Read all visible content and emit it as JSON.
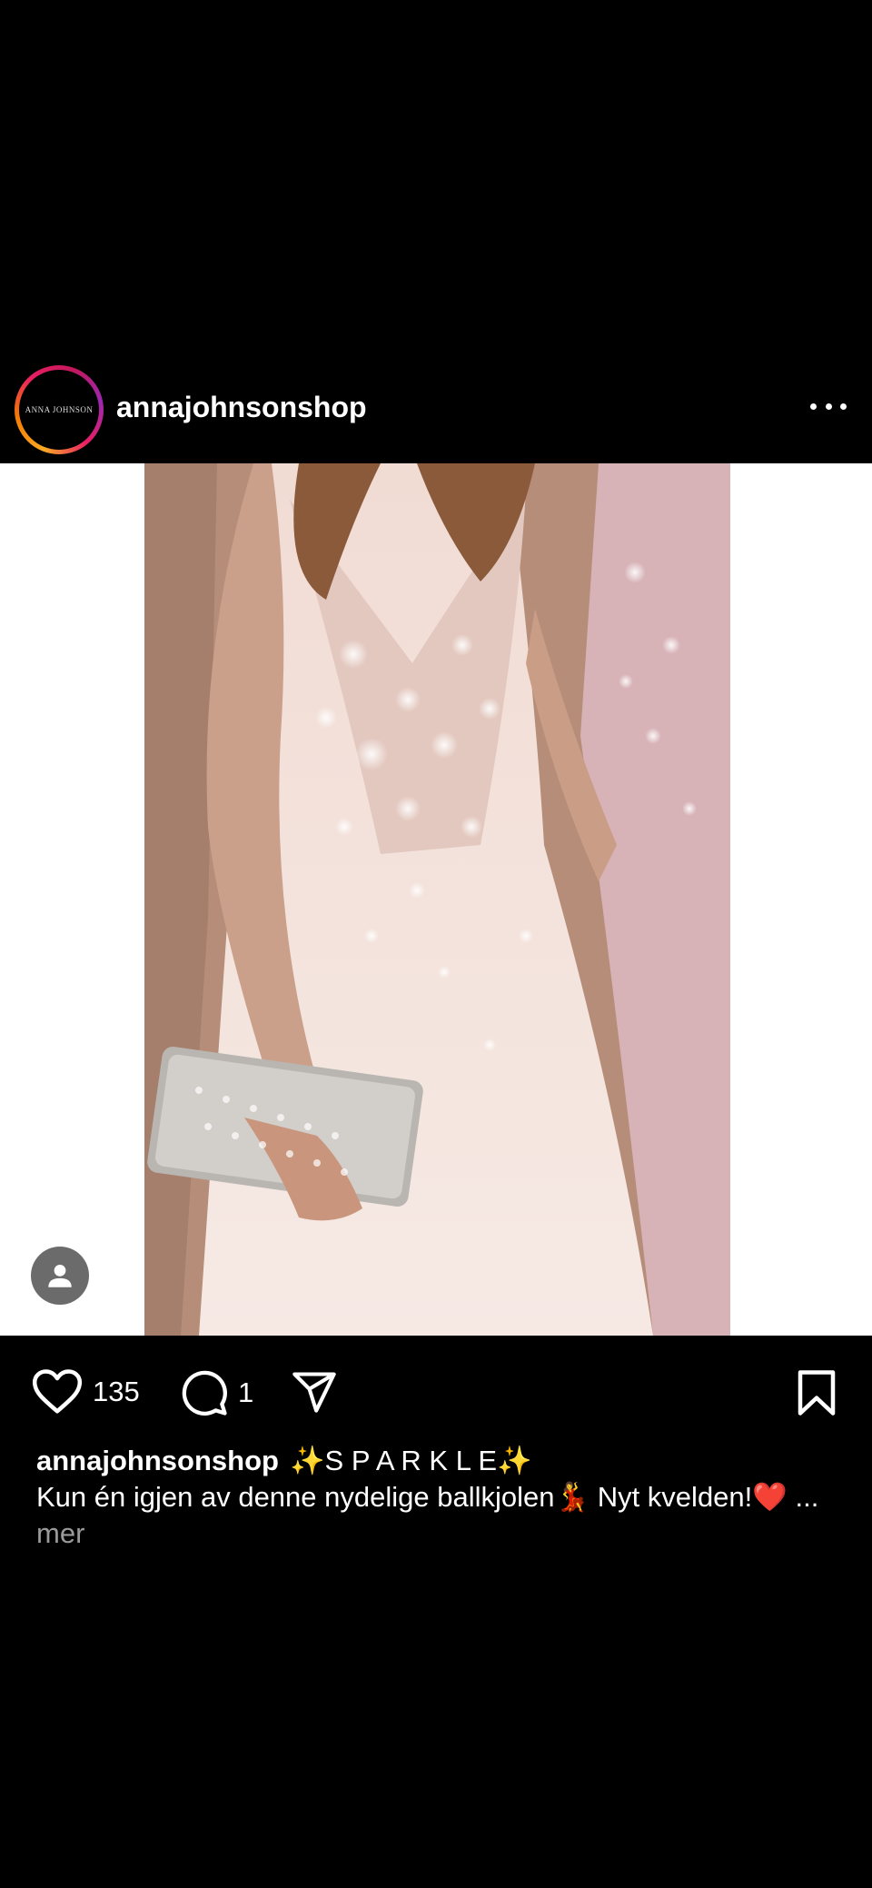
{
  "post": {
    "username": "annajohnsonshop",
    "avatar_text": "ANNA JOHNSON",
    "image_alt": "Pink sparkly ball gown with silver clutch",
    "likes": "135",
    "comments": "1",
    "caption_title": "✨S P A R K L E✨",
    "caption_text": "Kun én igjen av denne nydelige ballkjolen💃 Nyt kvelden!❤️",
    "ellipsis": "...",
    "more_label": "mer"
  },
  "icons": {
    "more": "more-horizontal-icon",
    "like": "heart-icon",
    "comment": "comment-bubble-icon",
    "share": "paper-plane-icon",
    "save": "bookmark-icon",
    "user_tag": "user-tag-icon"
  },
  "colors": {
    "background": "#000000",
    "text": "#ffffff",
    "muted": "#9a9a9a",
    "ring_start": "#f9a825",
    "ring_end": "#c2185b"
  }
}
